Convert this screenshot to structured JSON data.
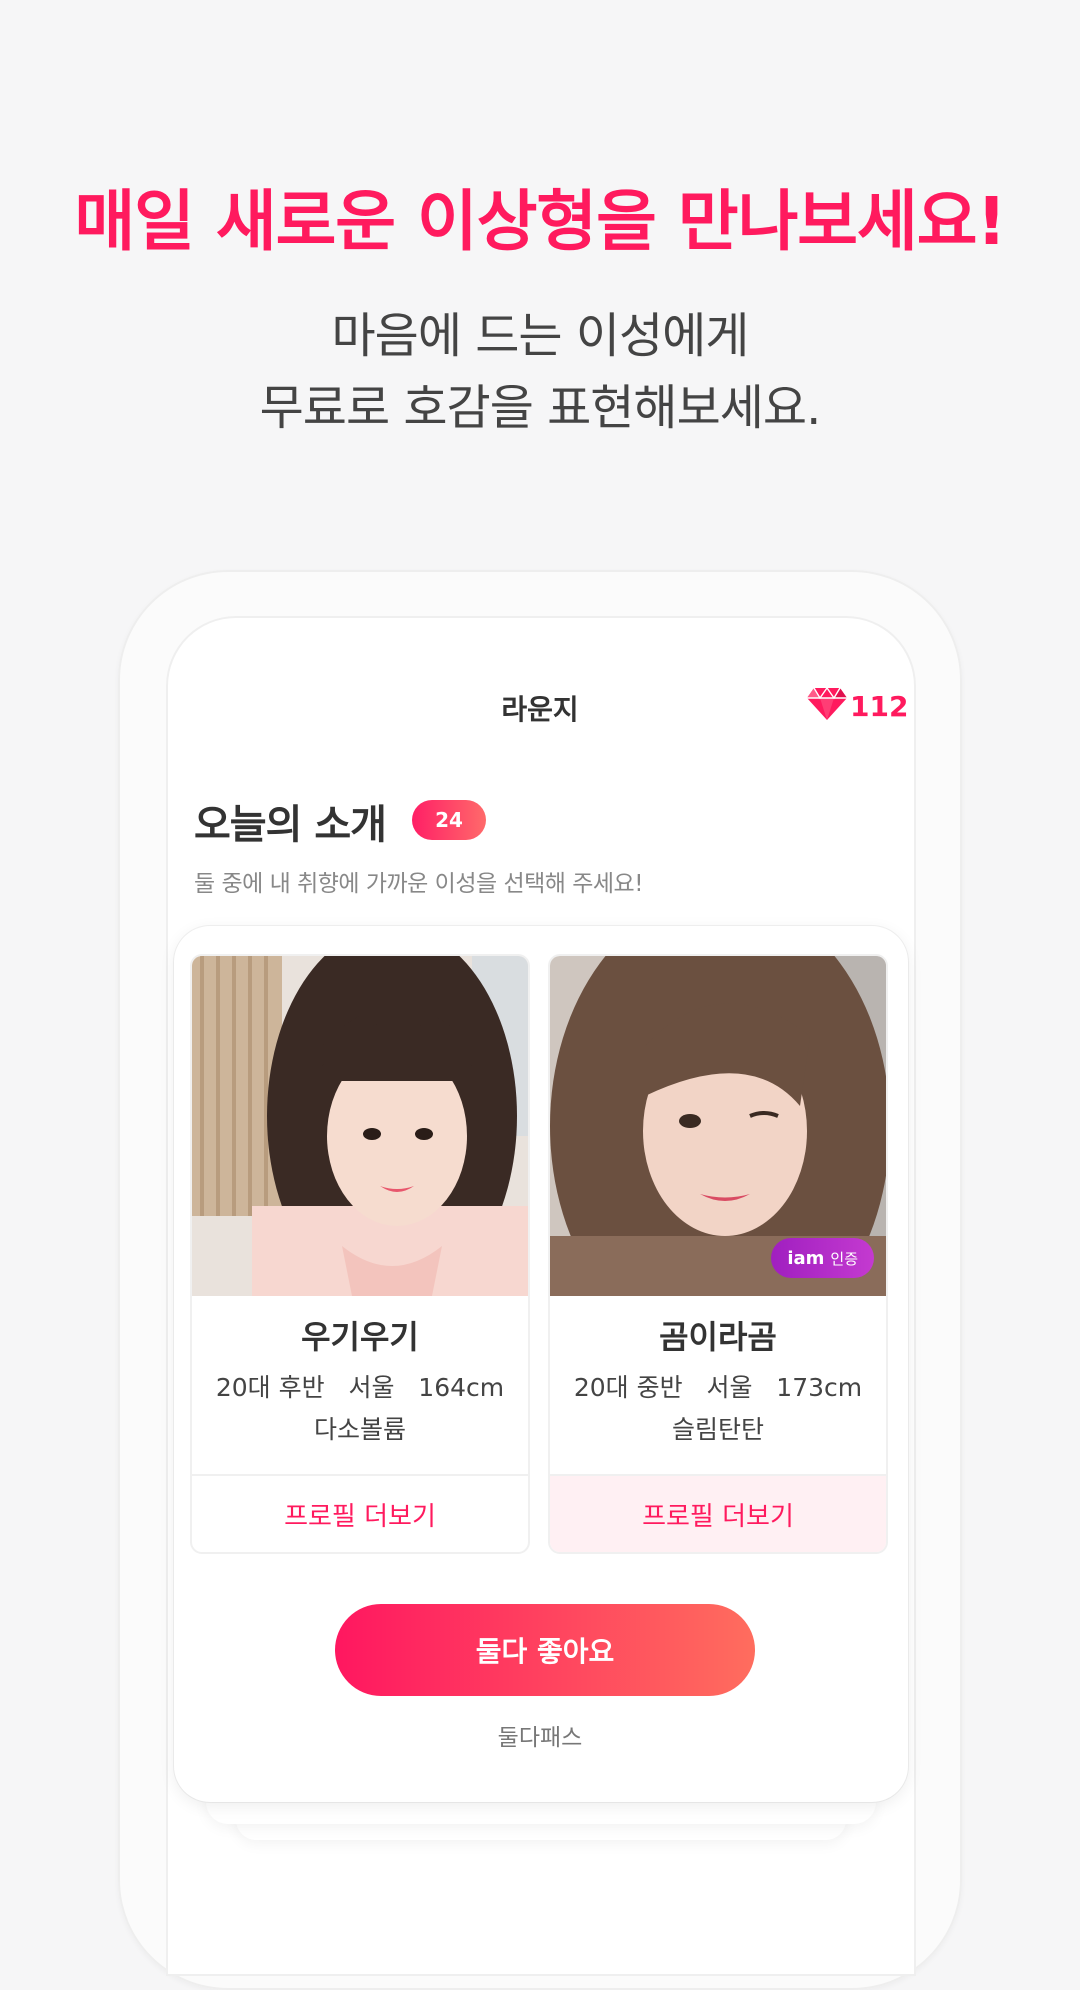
{
  "promo": {
    "title": "매일 새로운 이상형을 만나보세요!",
    "subtitle_line1": "마음에 드는 이성에게",
    "subtitle_line2": "무료로 호감을 표현해보세요."
  },
  "topbar": {
    "title": "라운지",
    "gem_count": "112"
  },
  "today": {
    "title": "오늘의 소개",
    "count": "24",
    "description": "둘 중에 내 취향에 가까운 이성을 선택해 주세요!"
  },
  "profiles": [
    {
      "name": "우기우기",
      "info": "20대 후반   서울   164cm",
      "body": "다소볼륨",
      "more_label": "프로필 더보기"
    },
    {
      "name": "곰이라곰",
      "info": "20대 중반   서울   173cm",
      "body": "슬림탄탄",
      "more_label": "프로필 더보기",
      "badge_main": "iam",
      "badge_sub": "인증"
    }
  ],
  "actions": {
    "like_both": "둘다 좋아요",
    "pass_both": "둘다패스"
  },
  "colors": {
    "accent": "#ff1a5e",
    "badge_purple": "#b02bc8"
  }
}
